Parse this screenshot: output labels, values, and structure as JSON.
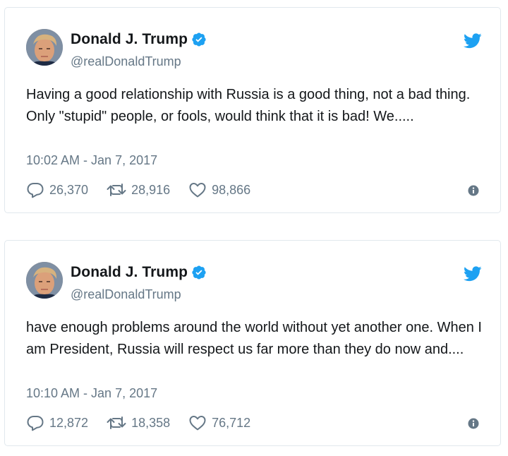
{
  "colors": {
    "verified": "#1da1f2",
    "twitter_blue": "#1da1f2",
    "secondary_text": "#657786",
    "border": "#e1e8ed"
  },
  "tweets": [
    {
      "name": "Donald J. Trump",
      "handle": "@realDonaldTrump",
      "text": "Having a good relationship with Russia is a good thing, not a bad thing. Only \"stupid\" people, or fools, would think that it is bad! We.....",
      "timestamp": "10:02 AM - Jan 7, 2017",
      "replies": "26,370",
      "retweets": "28,916",
      "likes": "98,866",
      "icons": [
        "avatar",
        "verified-badge-icon",
        "twitter-bird-icon",
        "reply-icon",
        "retweet-icon",
        "heart-icon",
        "info-icon"
      ]
    },
    {
      "name": "Donald J. Trump",
      "handle": "@realDonaldTrump",
      "text": "have enough problems around the world without yet another one. When I am President, Russia will respect us far more than they do now and....",
      "timestamp": "10:10 AM - Jan 7, 2017",
      "replies": "12,872",
      "retweets": "18,358",
      "likes": "76,712",
      "icons": [
        "avatar",
        "verified-badge-icon",
        "twitter-bird-icon",
        "reply-icon",
        "retweet-icon",
        "heart-icon",
        "info-icon"
      ]
    }
  ]
}
